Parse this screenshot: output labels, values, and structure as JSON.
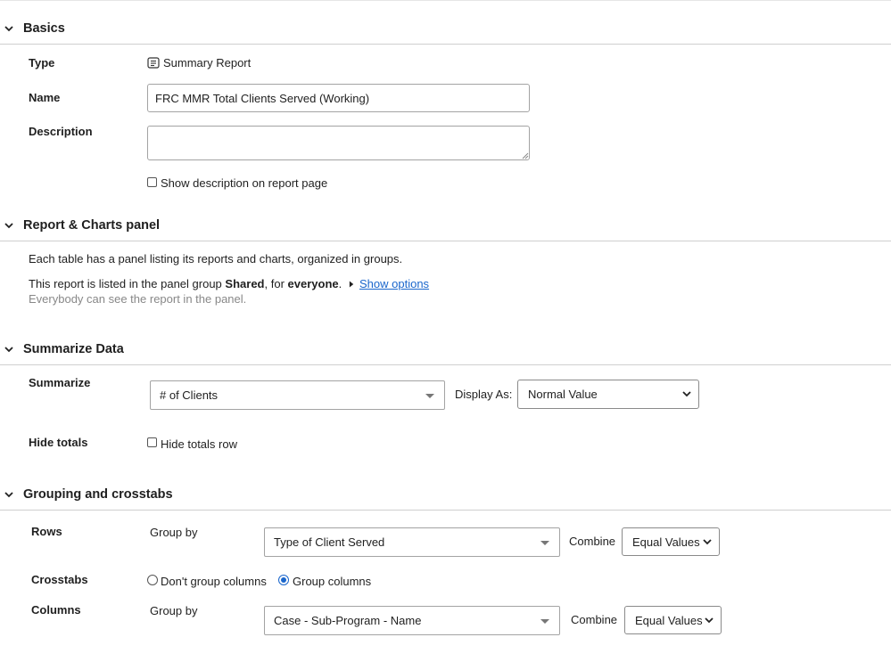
{
  "sections": {
    "basics": "Basics",
    "panel": "Report & Charts panel",
    "summarize": "Summarize Data",
    "grouping": "Grouping and crosstabs"
  },
  "basics": {
    "type_label": "Type",
    "type_value": "Summary Report",
    "name_label": "Name",
    "name_value": "FRC MMR Total Clients Served (Working)",
    "description_label": "Description",
    "description_value": "",
    "show_description_label": "Show description on report page"
  },
  "panel": {
    "intro": "Each table has a panel listing its reports and charts, organized in groups.",
    "listed_prefix": "This report is listed in the panel group",
    "group_name": "Shared",
    "listed_mid": ", for",
    "audience": "everyone",
    "listed_end": ".",
    "show_options": "Show options",
    "note": "Everybody can see the report in the panel."
  },
  "summarize": {
    "summarize_label": "Summarize",
    "summarize_value": "# of Clients",
    "display_as_label": "Display As:",
    "display_as_value": "Normal Value",
    "hide_totals_label": "Hide totals",
    "hide_totals_row_label": "Hide totals row"
  },
  "grouping": {
    "rows_label": "Rows",
    "rows_group_by": "Group by",
    "rows_value": "Type of Client Served",
    "rows_combine_label": "Combine",
    "rows_combine_value": "Equal Values",
    "crosstabs_label": "Crosstabs",
    "dont_group_label": "Don't group columns",
    "group_columns_label": "Group columns",
    "columns_label": "Columns",
    "columns_group_by": "Group by",
    "columns_value": "Case - Sub-Program - Name",
    "columns_combine_label": "Combine",
    "columns_combine_value": "Equal Values"
  },
  "icons": {
    "chevron": "chevron-down-icon",
    "report": "summary-report-icon"
  },
  "colors": {
    "link": "#1a66cc",
    "radio_selected": "#1a66cc"
  }
}
